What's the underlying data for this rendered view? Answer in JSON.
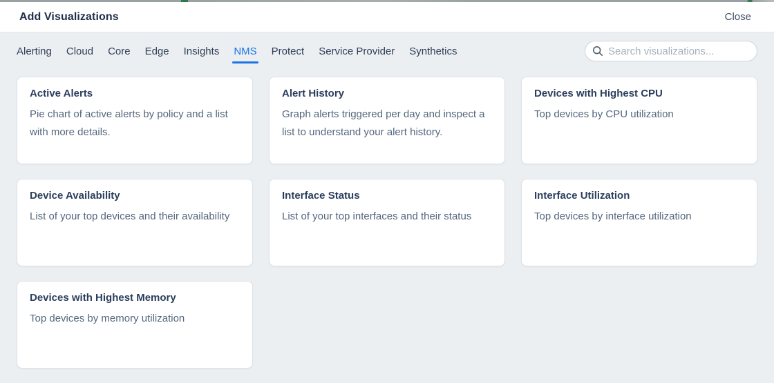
{
  "page": {
    "title": "Add Visualizations",
    "close_label": "Close"
  },
  "tabs": {
    "active": "NMS",
    "items": [
      {
        "label": "Alerting"
      },
      {
        "label": "Cloud"
      },
      {
        "label": "Core"
      },
      {
        "label": "Edge"
      },
      {
        "label": "Insights"
      },
      {
        "label": "NMS"
      },
      {
        "label": "Protect"
      },
      {
        "label": "Service Provider"
      },
      {
        "label": "Synthetics"
      }
    ]
  },
  "search": {
    "placeholder": "Search visualizations...",
    "value": ""
  },
  "icons": {
    "search": "magnifying-glass"
  },
  "cards": [
    {
      "title": "Active Alerts",
      "description": "Pie chart of active alerts by policy and a list with more details."
    },
    {
      "title": "Alert History",
      "description": "Graph alerts triggered per day and inspect a list to understand your alert history."
    },
    {
      "title": "Devices with Highest CPU",
      "description": "Top devices by CPU utilization"
    },
    {
      "title": "Device Availability",
      "description": "List of your top devices and their availability"
    },
    {
      "title": "Interface Status",
      "description": "List of your top interfaces and their status"
    },
    {
      "title": "Interface Utilization",
      "description": "Top devices by interface utilization"
    },
    {
      "title": "Devices with Highest Memory",
      "description": "Top devices by memory utilization"
    }
  ],
  "colors": {
    "accent_blue": "#1a73e8",
    "title_navy": "#21304a",
    "card_title_navy": "#2b3e5c",
    "body_text": "#55677c",
    "background_gray": "#eceff2",
    "card_border": "#dce2e8"
  }
}
